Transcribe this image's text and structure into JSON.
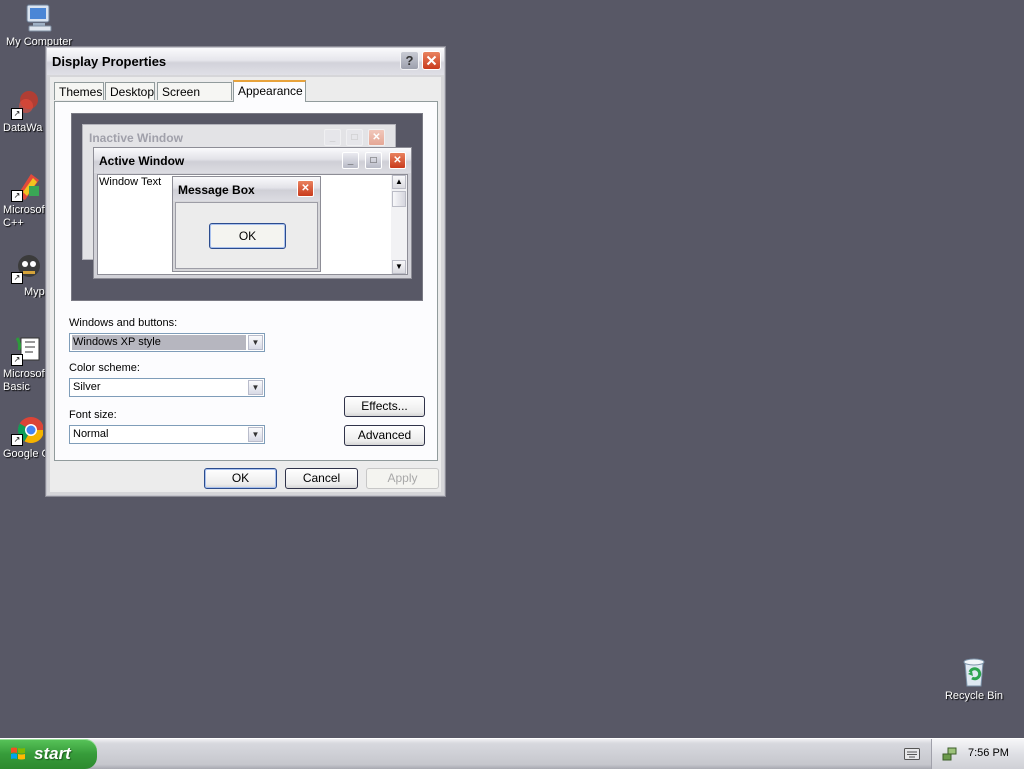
{
  "desktop": {
    "icons": [
      {
        "label": "My Computer"
      },
      {
        "label": "DataWa"
      },
      {
        "label": "Microsoft\nC++"
      },
      {
        "label": "Myp"
      },
      {
        "label": "Microsoft\nBasic"
      },
      {
        "label": "Google C"
      }
    ],
    "recycle_bin": {
      "label": "Recycle Bin"
    }
  },
  "dialog": {
    "title": "Display Properties",
    "help_label": "?",
    "tabs": [
      {
        "label": "Themes"
      },
      {
        "label": "Desktop"
      },
      {
        "label": "Screen Saver"
      },
      {
        "label": "Appearance",
        "active": true
      }
    ],
    "preview": {
      "inactive_title": "Inactive Window",
      "active_title": "Active Window",
      "window_text": "Window Text",
      "message_box_title": "Message Box",
      "message_box_ok": "OK"
    },
    "windows_buttons": {
      "label": "Windows and buttons:",
      "value": "Windows XP style"
    },
    "color_scheme": {
      "label": "Color scheme:",
      "value": "Silver"
    },
    "font_size": {
      "label": "Font size:",
      "value": "Normal"
    },
    "effects_label": "Effects...",
    "advanced_label": "Advanced",
    "ok_label": "OK",
    "cancel_label": "Cancel",
    "apply_label": "Apply"
  },
  "taskbar": {
    "start_label": "start",
    "clock": "7:56 PM"
  }
}
